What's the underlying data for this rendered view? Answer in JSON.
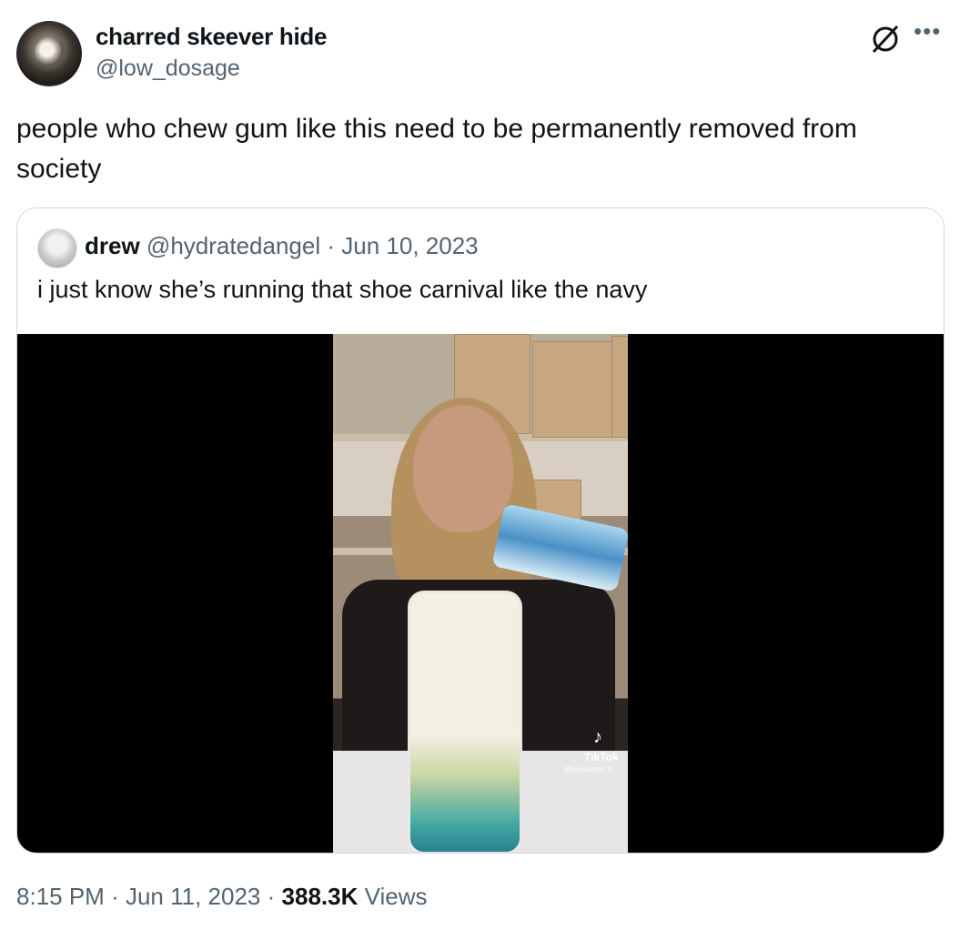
{
  "author": {
    "display_name": "charred skeever hide",
    "handle": "@low_dosage"
  },
  "tweet": {
    "text": "people who chew gum like this need to be permanently removed from society"
  },
  "quote": {
    "display_name": "drew",
    "handle": "@hydratedangel",
    "separator": "·",
    "date": "Jun 10, 2023",
    "text": "i just know she’s running that shoe carnival like the navy",
    "media": {
      "overlay_logo": "♪",
      "overlay_label": "TikTok",
      "overlay_handle": "@crystalynn_8"
    }
  },
  "meta": {
    "time": "8:15 PM",
    "sep1": "·",
    "date": "Jun 11, 2023",
    "sep2": "·",
    "views_count": "388.3K",
    "views_label": "Views"
  },
  "icons": {
    "grok": "grok-icon",
    "more": "more-icon"
  }
}
